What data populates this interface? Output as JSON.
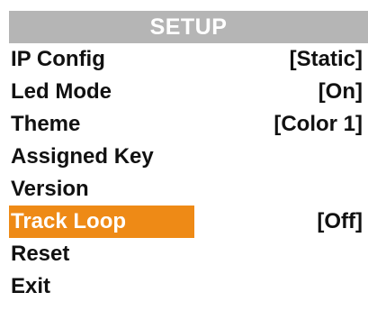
{
  "colors": {
    "header_bg": "#b5b5b5",
    "selection_bg": "#ee8a16",
    "text": "#111111",
    "selected_text": "#ffffff"
  },
  "header": {
    "title": "SETUP"
  },
  "menu": {
    "selected_index": 5,
    "items": [
      {
        "label": "IP Config",
        "value": "[Static]"
      },
      {
        "label": "Led Mode",
        "value": "[On]"
      },
      {
        "label": "Theme",
        "value": "[Color 1]"
      },
      {
        "label": "Assigned Key",
        "value": ""
      },
      {
        "label": "Version",
        "value": ""
      },
      {
        "label": "Track Loop",
        "value": "[Off]"
      },
      {
        "label": "Reset",
        "value": ""
      },
      {
        "label": "Exit",
        "value": ""
      }
    ]
  }
}
